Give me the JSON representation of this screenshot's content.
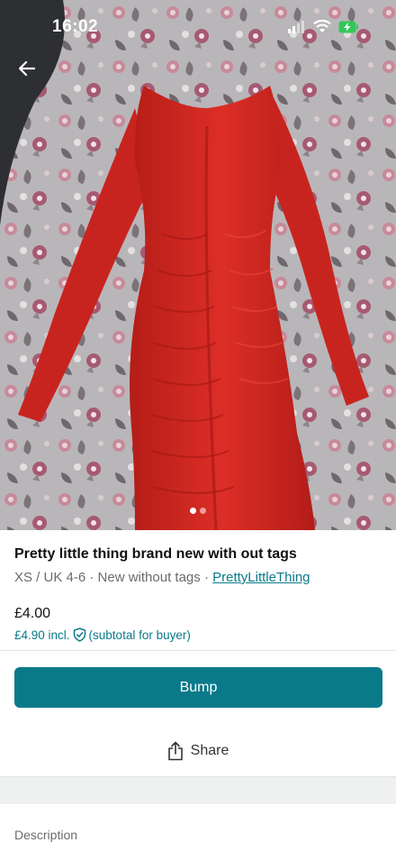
{
  "status_bar": {
    "time": "16:02"
  },
  "photo": {
    "count": 2,
    "active": 0
  },
  "listing": {
    "title": "Pretty little thing brand new with out tags",
    "size": "XS / UK 4-6",
    "sep1": " · ",
    "condition": "New without tags",
    "sep2": " · ",
    "brand": "PrettyLittleThing",
    "price": "£4.00",
    "price_incl": "£4.90 incl.",
    "price_note": "(subtotal for buyer)"
  },
  "actions": {
    "bump_label": "Bump",
    "share_label": "Share"
  },
  "description": {
    "label": "Description"
  },
  "colors": {
    "accent": "#0a7a8a",
    "dress": "#d42a23"
  }
}
